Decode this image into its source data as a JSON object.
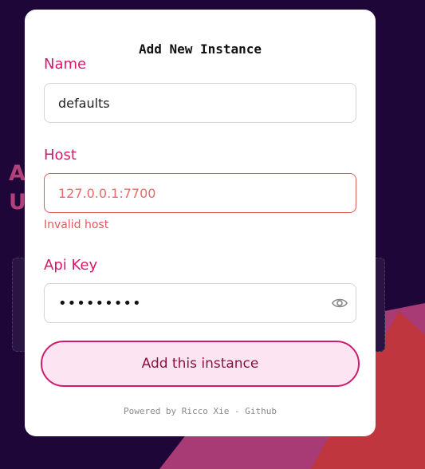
{
  "background": {
    "partial_text_lines": [
      "A",
      "U"
    ]
  },
  "modal": {
    "title": "Add New Instance",
    "name_label": "Name",
    "name_value": "defaults",
    "host_label": "Host",
    "host_value": "127.0.0.1:7700",
    "host_error": "Invalid host",
    "api_key_label": "Api Key",
    "api_key_value": "•••••••••",
    "submit_label": "Add this instance",
    "footer_prefix": "Powered by Ricco Xie - ",
    "footer_link": "Github"
  },
  "colors": {
    "background": "#1f0639",
    "accent": "#d6186d",
    "error": "#e05a5a",
    "button_fill": "#fde4f3"
  },
  "icons": {
    "password_toggle": "eye-icon"
  }
}
